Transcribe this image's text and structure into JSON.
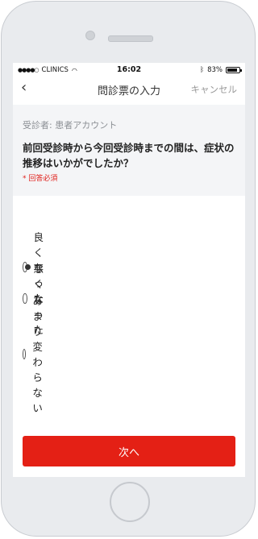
{
  "status_bar": {
    "carrier": "CLINICS",
    "time": "16:02",
    "battery_text": "83%",
    "battery_level": 0.83
  },
  "nav": {
    "back": "‹",
    "title": "問診票の入力",
    "cancel": "キャンセル"
  },
  "question": {
    "patient": "受診者: 患者アカウント",
    "text": "前回受診時から今回受診時までの間は、症状の推移はいかがでしたか？",
    "required": "* 回答必須"
  },
  "options": [
    {
      "label": "良くなった",
      "selected": true
    },
    {
      "label": "悪くなった",
      "selected": false
    },
    {
      "label": "あまり変わらない",
      "selected": false
    }
  ],
  "next_button": "次へ"
}
